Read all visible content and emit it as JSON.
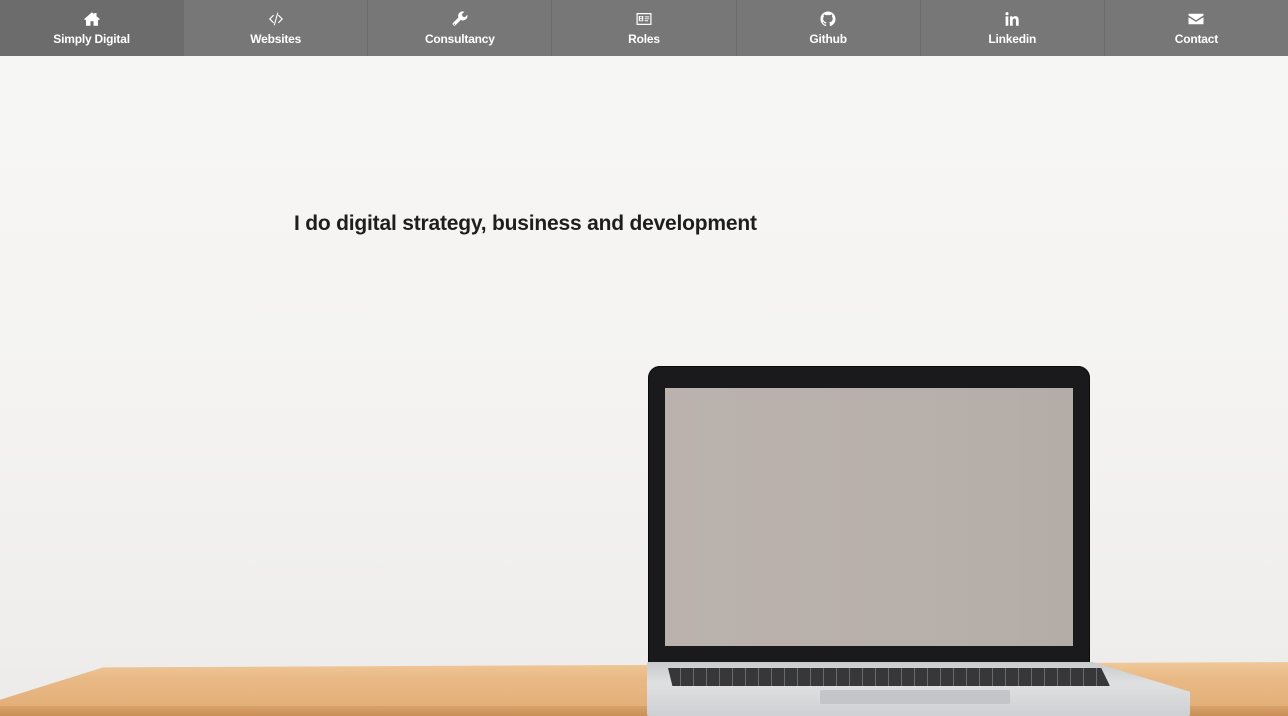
{
  "nav": {
    "items": [
      {
        "label": "Simply Digital",
        "icon": "home-icon",
        "active": true
      },
      {
        "label": "Websites",
        "icon": "code-icon",
        "active": false
      },
      {
        "label": "Consultancy",
        "icon": "wrench-icon",
        "active": false
      },
      {
        "label": "Roles",
        "icon": "id-card-icon",
        "active": false
      },
      {
        "label": "Github",
        "icon": "github-icon",
        "active": false
      },
      {
        "label": "Linkedin",
        "icon": "linkedin-icon",
        "active": false
      },
      {
        "label": "Contact",
        "icon": "envelope-icon",
        "active": false
      }
    ]
  },
  "hero": {
    "headline": "I do digital strategy, business and development"
  },
  "colors": {
    "nav_background": "#777777",
    "nav_active": "#6c6c6c",
    "nav_text": "#ffffff",
    "headline_text": "#1e1e1e"
  }
}
